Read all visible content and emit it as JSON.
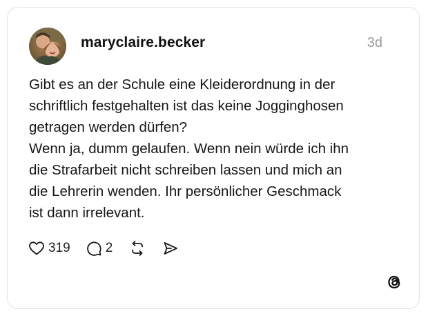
{
  "post": {
    "username": "maryclaire.becker",
    "timestamp": "3d",
    "text_lines": [
      "Gibt es an der Schule eine Kleiderordnung in der",
      "schriftlich festgehalten ist das keine Jogginghosen",
      "getragen werden dürfen?",
      "Wenn ja, dumm gelaufen. Wenn nein würde ich ihn",
      "die Strafarbeit nicht schreiben lassen und mich an",
      "die Lehrerin wenden. Ihr persönlicher Geschmack",
      "ist dann irrelevant."
    ]
  },
  "actions": {
    "like_count": "319",
    "reply_count": "2",
    "like_icon": "heart-icon",
    "reply_icon": "speech-bubble-icon",
    "repost_icon": "repost-icon",
    "share_icon": "send-icon"
  },
  "brand": {
    "logo_icon": "threads-logo-icon"
  },
  "colors": {
    "text": "#101010",
    "muted": "#9a9a9a",
    "border": "#e3e3e3"
  }
}
